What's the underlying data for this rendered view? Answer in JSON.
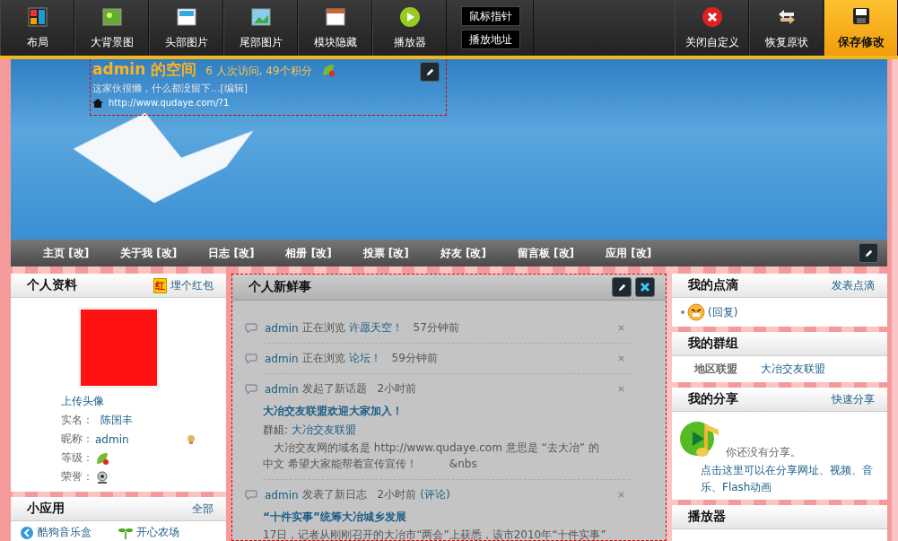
{
  "toolbar": {
    "items": [
      {
        "kind": "layout",
        "label": "布局"
      },
      {
        "kind": "background",
        "label": "大背景图"
      },
      {
        "kind": "header",
        "label": "头部图片"
      },
      {
        "kind": "footer",
        "label": "尾部图片"
      },
      {
        "kind": "modules",
        "label": "模块隐藏"
      },
      {
        "kind": "player",
        "label": "播放器"
      }
    ],
    "small_buttons": [
      "鼠标指针",
      "播放地址"
    ],
    "actions": [
      {
        "kind": "close",
        "label": "关闭自定义"
      },
      {
        "kind": "restore",
        "label": "恢复原状"
      },
      {
        "kind": "save",
        "label": "保存修改"
      }
    ]
  },
  "header": {
    "title": "admin 的空间",
    "stats": "6 人次访问, 49个积分",
    "motto": "这家伙很懒，什么都没留下...",
    "motto_edit": "[编辑]",
    "url": "http://www.qudaye.com/?1"
  },
  "nav": [
    {
      "label": "主页",
      "edit": "[改]"
    },
    {
      "label": "关于我",
      "edit": "[改]"
    },
    {
      "label": "日志",
      "edit": "[改]"
    },
    {
      "label": "相册",
      "edit": "[改]"
    },
    {
      "label": "投票",
      "edit": "[改]"
    },
    {
      "label": "好友",
      "edit": "[改]"
    },
    {
      "label": "留言板",
      "edit": "[改]"
    },
    {
      "label": "应用",
      "edit": "[改]"
    }
  ],
  "profile": {
    "title": "个人资料",
    "action": "埋个红包",
    "action_badge": "红",
    "upload": "上传头像",
    "fields": [
      {
        "kind": "text",
        "label": "实名：",
        "value": "陈国丰"
      },
      {
        "kind": "nickname",
        "label": "昵称：",
        "value": "admin"
      },
      {
        "kind": "level",
        "label": "等级："
      },
      {
        "kind": "honor",
        "label": "荣誉："
      }
    ]
  },
  "apps": {
    "title": "小应用",
    "action": "全部",
    "items": [
      {
        "kind": "music",
        "label": "酷狗音乐盒"
      },
      {
        "kind": "farm",
        "label": "开心农场"
      }
    ]
  },
  "feed": {
    "title": "个人新鲜事",
    "items": [
      {
        "kind": "browse",
        "user": "admin",
        "action": "正在浏览",
        "target": "许愿天空！",
        "time": "57分钟前"
      },
      {
        "kind": "browse",
        "user": "admin",
        "action": "正在浏览",
        "target": "论坛！",
        "time": "59分钟前"
      },
      {
        "kind": "topic",
        "user": "admin",
        "action": "发起了新话题",
        "time": "2小时前",
        "title": "大冶交友联盟欢迎大家加入！",
        "group_label": "群組:",
        "group": "大冶交友联盟",
        "body": "　大冶交友网的域名是 http://www.qudaye.com 意思是 “去大冶” 的中文  希望大家能帮着宣传宣传！　　　&nbs"
      },
      {
        "kind": "blog",
        "user": "admin",
        "action": "发表了新日志",
        "time": "2小时前",
        "comment": "(评论)",
        "title": "“十件实事”统筹大冶城乡发展",
        "body": "17日，记者从刚刚召开的大冶市“两会”上获悉，该市2010年“十件实事”"
      }
    ]
  },
  "doings": {
    "title": "我的点滴",
    "action": "发表点滴",
    "reply": "(回复)"
  },
  "groups": {
    "title": "我的群组",
    "category": "地区联盟",
    "group": "大冶交友联盟"
  },
  "share": {
    "title": "我的分享",
    "action": "快速分享",
    "empty": "你还没有分享。",
    "link": "点击这里可以在分享网址、视频、音乐、Flash动画"
  },
  "player": {
    "title": "播放器"
  }
}
